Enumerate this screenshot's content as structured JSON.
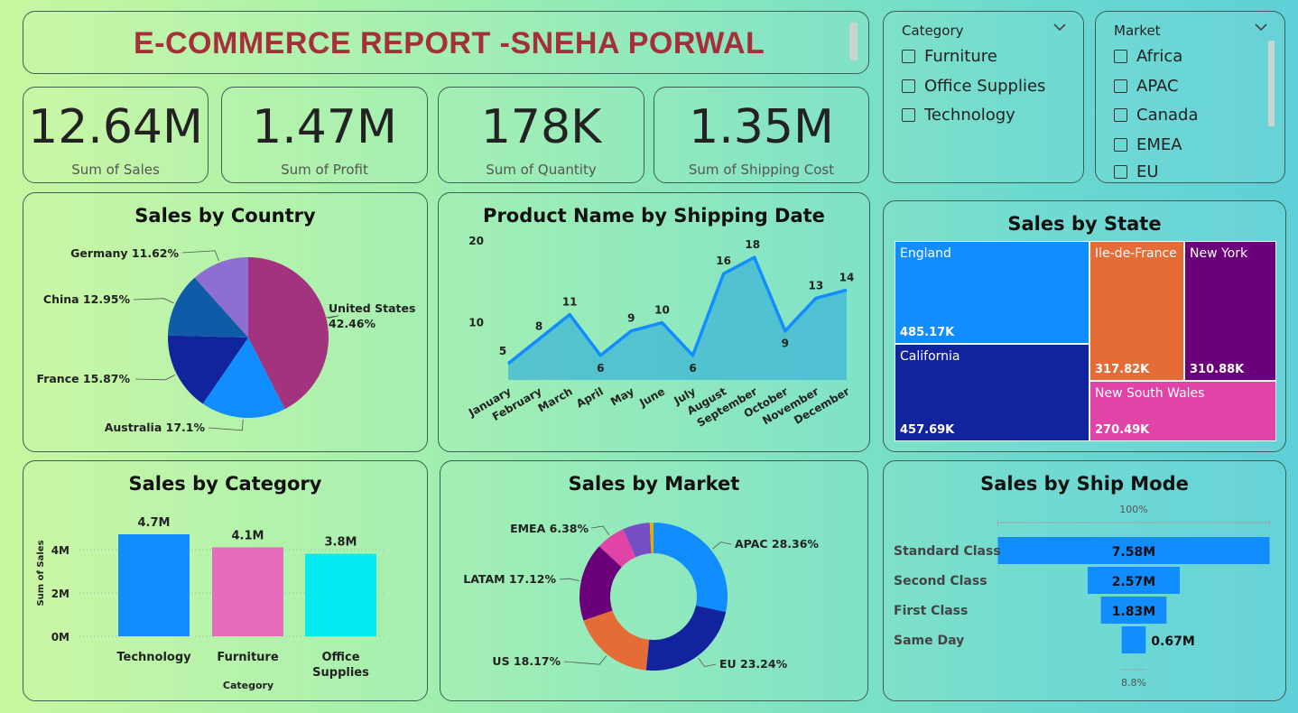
{
  "header": {
    "title": "E-COMMERCE REPORT -SNEHA PORWAL"
  },
  "kpis": [
    {
      "value": "12.64M",
      "label": "Sum of Sales"
    },
    {
      "value": "1.47M",
      "label": "Sum of Profit"
    },
    {
      "value": "178K",
      "label": "Sum of Quantity"
    },
    {
      "value": "1.35M",
      "label": "Sum of Shipping Cost"
    }
  ],
  "slicers": {
    "category": {
      "title": "Category",
      "items": [
        "Furniture",
        "Office Supplies",
        "Technology"
      ]
    },
    "market": {
      "title": "Market",
      "items": [
        "Africa",
        "APAC",
        "Canada",
        "EMEA",
        "EU"
      ]
    }
  },
  "colors": {
    "title_red": "#a5303a",
    "blue": "#118dff",
    "navy": "#12239e",
    "orange": "#e66c37",
    "purple": "#6b007b",
    "pink": "#e044a7",
    "magenta": "#a3337f",
    "lavender": "#8d6fd1",
    "steel": "#0f5ba8",
    "cyan": "#04eaf0",
    "bar_pink": "#e66bbc",
    "gold": "#d9b300"
  },
  "chart_data": [
    {
      "id": "country",
      "type": "pie",
      "title": "Sales by Country",
      "slices": [
        {
          "name": "United States",
          "label": "United States 42.46%",
          "value": 42.46,
          "color": "#a3337f"
        },
        {
          "name": "Australia",
          "label": "Australia 17.1%",
          "value": 17.1,
          "color": "#118dff"
        },
        {
          "name": "France",
          "label": "France 15.87%",
          "value": 15.87,
          "color": "#12239e"
        },
        {
          "name": "China",
          "label": "China 12.95%",
          "value": 12.95,
          "color": "#0f5ba8"
        },
        {
          "name": "Germany",
          "label": "Germany 11.62%",
          "value": 11.62,
          "color": "#8d6fd1"
        }
      ]
    },
    {
      "id": "shipping",
      "type": "area",
      "title": "Product Name by Shipping Date",
      "categories": [
        "January",
        "February",
        "March",
        "April",
        "May",
        "June",
        "July",
        "August",
        "September",
        "October",
        "November",
        "December"
      ],
      "values": [
        5,
        8,
        11,
        6,
        9,
        10,
        6,
        16,
        18,
        9,
        13,
        14
      ],
      "y_ticks": [
        10,
        20
      ],
      "ylim": [
        3,
        20
      ]
    },
    {
      "id": "state",
      "type": "treemap",
      "title": "Sales by State",
      "items": [
        {
          "name": "England",
          "value": "485.17K",
          "color": "#118dff"
        },
        {
          "name": "California",
          "value": "457.69K",
          "color": "#12239e"
        },
        {
          "name": "Ile-de-France",
          "value": "317.82K",
          "color": "#e66c37"
        },
        {
          "name": "New York",
          "value": "310.88K",
          "color": "#6b007b"
        },
        {
          "name": "New South Wales",
          "value": "270.49K",
          "color": "#e044a7"
        }
      ]
    },
    {
      "id": "category",
      "type": "bar",
      "title": "Sales by Category",
      "categories": [
        "Technology",
        "Furniture",
        "Office Supplies"
      ],
      "values": [
        4.7,
        4.1,
        3.8
      ],
      "data_labels": [
        "4.7M",
        "4.1M",
        "3.8M"
      ],
      "colors": [
        "#118dff",
        "#e66bbc",
        "#04eaf0"
      ],
      "xlabel": "Category",
      "ylabel": "Sum of Sales",
      "y_ticks": [
        "0M",
        "2M",
        "4M"
      ],
      "y_tick_values": [
        0,
        2,
        4
      ],
      "ylim": [
        0,
        4.7
      ]
    },
    {
      "id": "market",
      "type": "pie",
      "title": "Sales by Market",
      "slices": [
        {
          "name": "APAC",
          "label": "APAC 28.36%",
          "value": 28.36,
          "color": "#118dff"
        },
        {
          "name": "EU",
          "label": "EU 23.24%",
          "value": 23.24,
          "color": "#12239e"
        },
        {
          "name": "US",
          "label": "US 18.17%",
          "value": 18.17,
          "color": "#e66c37"
        },
        {
          "name": "LATAM",
          "label": "LATAM 17.12%",
          "value": 17.12,
          "color": "#6b007b"
        },
        {
          "name": "EMEA",
          "label": "EMEA 6.38%",
          "value": 6.38,
          "color": "#e044a7"
        },
        {
          "name": "Africa",
          "label": "",
          "value": 5.9,
          "color": "#744ec2"
        },
        {
          "name": "Canada",
          "label": "",
          "value": 0.83,
          "color": "#d9b300"
        }
      ]
    },
    {
      "id": "shipmode",
      "type": "bar",
      "title": "Sales by Ship Mode",
      "categories": [
        "Standard Class",
        "Second Class",
        "First Class",
        "Same Day"
      ],
      "values": [
        7.58,
        2.57,
        1.83,
        0.67
      ],
      "data_labels": [
        "7.58M",
        "2.57M",
        "1.83M",
        "0.67M"
      ],
      "top_label": "100%",
      "bottom_label": "8.8%"
    }
  ]
}
